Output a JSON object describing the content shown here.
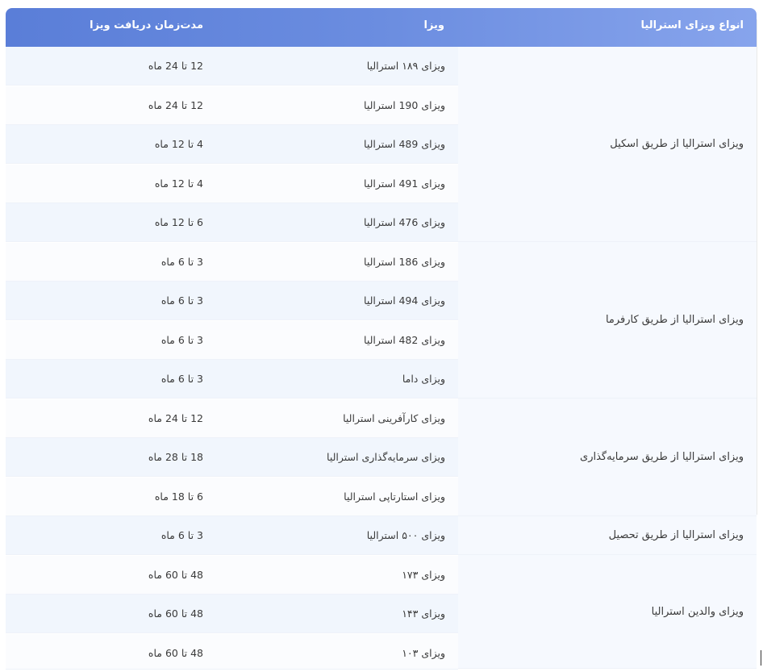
{
  "header": {
    "type_label": "انواع ویزای استرالیا",
    "visa_label": "ویزا",
    "duration_label": "مدت‌زمان دریافت ویزا"
  },
  "groups": [
    {
      "label": "ویزای استرالیا از طریق اسکیل"
    },
    {
      "label": "ویزای استرالیا از طریق کارفرما"
    },
    {
      "label": "ویزای استرالیا از طریق سرمایه‌گذاری"
    },
    {
      "label": "ویزای استرالیا از طریق تحصیل"
    },
    {
      "label": "ویزای والدین استرالیا"
    }
  ],
  "rows": [
    {
      "visa": "ویزای ۱۸۹ استرالیا",
      "duration": "12 تا 24 ماه"
    },
    {
      "visa": "ویزای 190 استرالیا",
      "duration": "12 تا 24 ماه"
    },
    {
      "visa": "ویزای 489 استرالیا",
      "duration": "4 تا 12 ماه"
    },
    {
      "visa": "ویزای 491 استرالیا",
      "duration": "4 تا 12 ماه"
    },
    {
      "visa": "ویزای 476 استرالیا",
      "duration": "6 تا 12 ماه"
    },
    {
      "visa": "ویزای 186 استرالیا",
      "duration": "3 تا 6 ماه"
    },
    {
      "visa": "ویزای 494 استرالیا",
      "duration": "3 تا 6 ماه"
    },
    {
      "visa": "ویزای 482 استرالیا",
      "duration": "3 تا 6 ماه"
    },
    {
      "visa": "ویزای داما",
      "duration": "3 تا 6 ماه"
    },
    {
      "visa": "ویزای کارآفرینی استرالیا",
      "duration": "12 تا 24 ماه"
    },
    {
      "visa": "ویزای سرمایه‌گذاری استرالیا",
      "duration": "18 تا 28 ماه"
    },
    {
      "visa": "ویزای استارتاپی استرالیا",
      "duration": "6 تا 18 ماه"
    },
    {
      "visa": "ویزای ۵۰۰ استرالیا",
      "duration": "3 تا 6 ماه"
    },
    {
      "visa": "ویزای ۱۷۳",
      "duration": "48 تا 60 ماه"
    },
    {
      "visa": "ویزای ۱۴۳",
      "duration": "48 تا 60 ماه"
    },
    {
      "visa": "ویزای ۱۰۳",
      "duration": "48 تا 60 ماه"
    }
  ],
  "colors": {
    "header_gradient_start": "#5a7ed8",
    "header_gradient_end": "#87a4ec",
    "row_alt": "#f1f6fd",
    "row_plain": "#fbfcfe",
    "group_cell": "#f6f9fe"
  }
}
